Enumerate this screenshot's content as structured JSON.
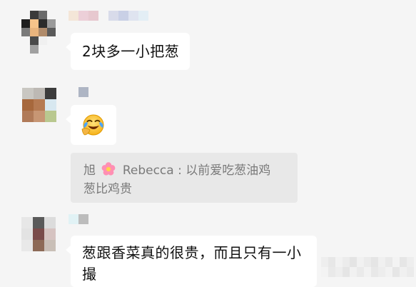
{
  "messages": [
    {
      "text": "2块多一小把葱"
    },
    {
      "emoji_name": "face-with-tears-of-joy"
    },
    {
      "quote": {
        "name": "旭",
        "nickname": "Rebecca",
        "separator": " : ",
        "line1": "以前爱吃葱油鸡",
        "line2": "葱比鸡贵"
      }
    },
    {
      "text_line1": "葱跟香菜真的很贵，而且只有一小",
      "text_line2": "撮"
    }
  ],
  "colors": {
    "background": "#f5f5f5",
    "bubble": "#ffffff",
    "quote_bg": "#e8e8e8",
    "quote_text": "#7a7a7a",
    "text": "#111111"
  }
}
